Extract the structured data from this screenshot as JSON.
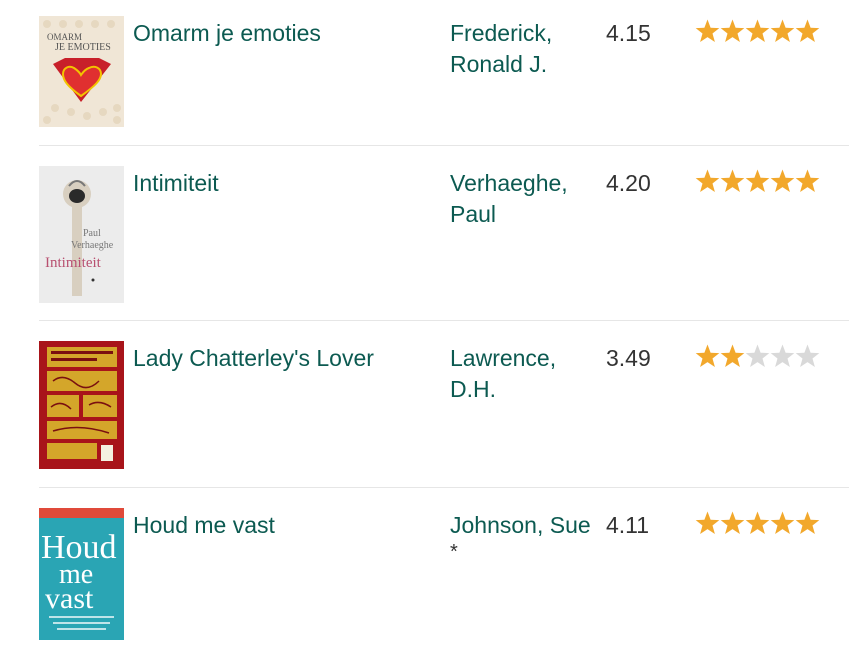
{
  "books": [
    {
      "title": "Omarm je emoties",
      "author_line1": "Frederick,",
      "author_line2": "Ronald J.",
      "author_extra": "",
      "avg_rating": "4.15",
      "user_rating": 5,
      "cover": {
        "text1": "OMARM",
        "text2": "JE EMOTIES",
        "bg": "#f0e6d6",
        "accent": "#c8202a"
      }
    },
    {
      "title": "Intimiteit",
      "author_line1": "Verhaeghe,",
      "author_line2": "Paul",
      "author_extra": "",
      "avg_rating": "4.20",
      "user_rating": 5,
      "cover": {
        "text1": "Paul",
        "text2": "Verhaeghe",
        "text3": "Intimiteit",
        "bg": "#ececec",
        "accent": "#b85070"
      }
    },
    {
      "title": "Lady Chatterley's Lover",
      "author_line1": "Lawrence,",
      "author_line2": "D.H.",
      "author_extra": "",
      "avg_rating": "3.49",
      "user_rating": 2,
      "cover": {
        "bg": "#a8141a",
        "accent": "#d4a62a"
      }
    },
    {
      "title": "Houd me vast",
      "author_line1": "Johnson, Sue",
      "author_line2": "",
      "author_extra": "*",
      "avg_rating": "4.11",
      "user_rating": 5,
      "cover": {
        "text1": "Houd",
        "text2": "me",
        "text3": "vast",
        "bg": "#2aa5b4",
        "accent": "#ffffff"
      }
    }
  ],
  "colors": {
    "link": "#0c5a51",
    "star_filled": "#f2a82c",
    "star_empty": "#d9d9d9",
    "divider": "#e6e6e6"
  }
}
